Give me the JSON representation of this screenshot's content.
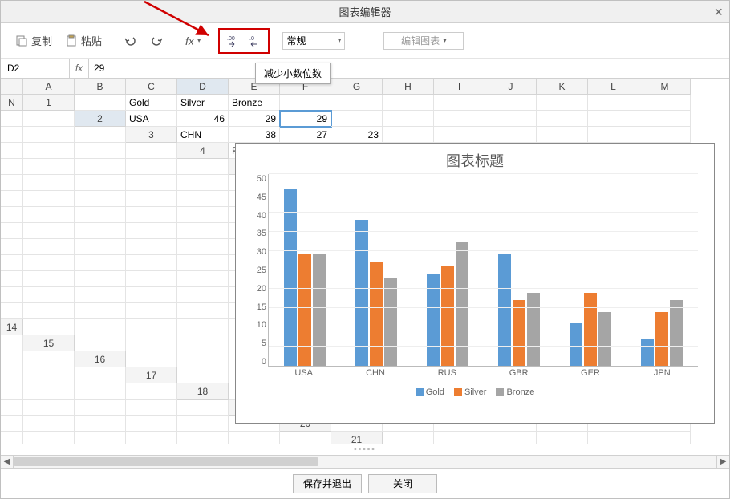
{
  "dialog": {
    "title": "图表编辑器"
  },
  "toolbar": {
    "copy": "复制",
    "paste": "粘贴",
    "format_select": "常规",
    "edit_chart": "编辑图表"
  },
  "tooltip": "减少小数位数",
  "formula_bar": {
    "cell_ref": "D2",
    "fx_label": "fx",
    "value": "29"
  },
  "columns": [
    "A",
    "B",
    "C",
    "D",
    "E",
    "F",
    "G",
    "H",
    "I",
    "J",
    "K",
    "L",
    "M",
    "N"
  ],
  "rows": 23,
  "table": {
    "headers": [
      "",
      "Gold",
      "Silver",
      "Bronze"
    ],
    "data": [
      [
        "USA",
        46,
        29,
        29
      ],
      [
        "CHN",
        38,
        27,
        23
      ],
      [
        "RUS",
        24,
        26,
        32
      ],
      [
        "GBR",
        29,
        17,
        19
      ],
      [
        "GER",
        11,
        19,
        14
      ],
      [
        "JPN",
        7,
        14,
        17
      ]
    ]
  },
  "active_cell": "D2",
  "chart_data": {
    "type": "bar",
    "title": "图表标题",
    "categories": [
      "USA",
      "CHN",
      "RUS",
      "GBR",
      "GER",
      "JPN"
    ],
    "series": [
      {
        "name": "Gold",
        "values": [
          46,
          38,
          24,
          29,
          11,
          7
        ],
        "color": "#5b9bd5"
      },
      {
        "name": "Silver",
        "values": [
          29,
          27,
          26,
          17,
          19,
          14
        ],
        "color": "#ed7d31"
      },
      {
        "name": "Bronze",
        "values": [
          29,
          23,
          32,
          19,
          14,
          17
        ],
        "color": "#a5a5a5"
      }
    ],
    "ylim": [
      0,
      50
    ],
    "yticks": [
      0,
      5,
      10,
      15,
      20,
      25,
      30,
      35,
      40,
      45,
      50
    ],
    "xlabel": "",
    "ylabel": ""
  },
  "footer": {
    "save_exit": "保存并退出",
    "close": "关闭"
  }
}
